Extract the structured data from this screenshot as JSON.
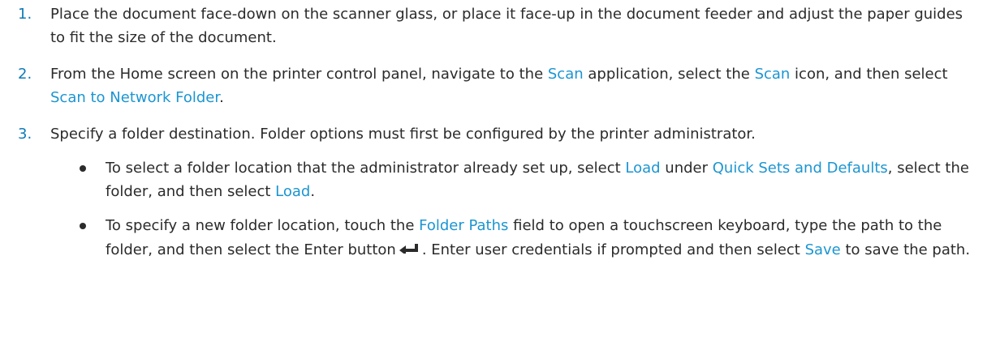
{
  "steps": [
    {
      "number": "1.",
      "text": "Place the document face-down on the scanner glass, or place it face-up in the document feeder and adjust the paper guides to fit the size of the document."
    },
    {
      "number": "2.",
      "parts": [
        "From the Home screen on the printer control panel, navigate to the ",
        "Scan",
        " application, select the ",
        "Scan",
        " icon, and then select ",
        "Scan to Network Folder",
        "."
      ]
    },
    {
      "number": "3.",
      "text": "Specify a folder destination. Folder options must first be configured by the printer administrator.",
      "bullets": [
        {
          "parts": [
            "To select a folder location that the administrator already set up, select ",
            "Load",
            " under ",
            "Quick Sets and Defaults",
            ", select the folder, and then select ",
            "Load",
            "."
          ]
        },
        {
          "parts": [
            "To specify a new folder location, touch the ",
            "Folder Paths",
            " field to open a touchscreen keyboard, type the path to the folder, and then select the Enter button",
            ". Enter user credentials if prompted and then select ",
            "Save",
            " to save the path."
          ],
          "icon": "enter-arrow-icon"
        }
      ]
    }
  ],
  "colors": {
    "step_number": "#0e7bb8",
    "ui_term": "#1b95d2",
    "body_text": "#2b2b2b"
  }
}
